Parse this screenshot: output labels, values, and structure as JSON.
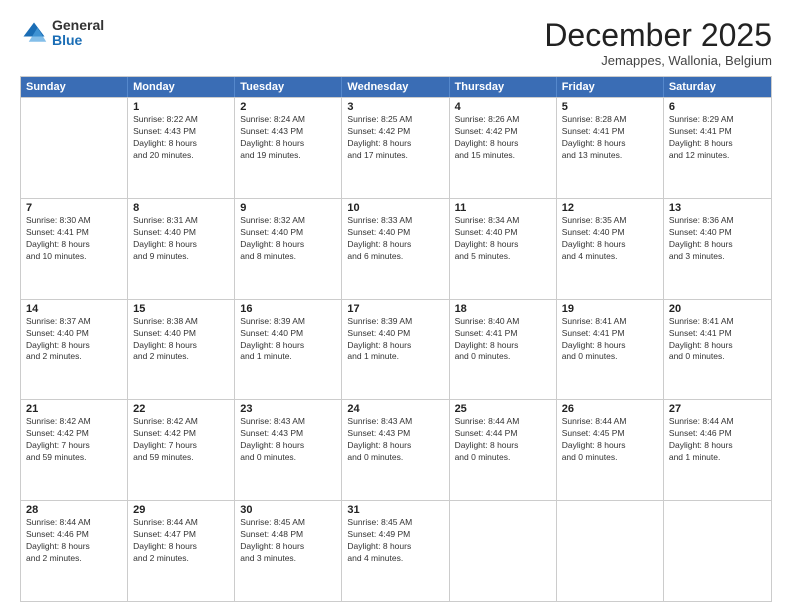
{
  "logo": {
    "general": "General",
    "blue": "Blue"
  },
  "title": "December 2025",
  "subtitle": "Jemappes, Wallonia, Belgium",
  "header_days": [
    "Sunday",
    "Monday",
    "Tuesday",
    "Wednesday",
    "Thursday",
    "Friday",
    "Saturday"
  ],
  "rows": [
    [
      {
        "day": "",
        "lines": []
      },
      {
        "day": "1",
        "lines": [
          "Sunrise: 8:22 AM",
          "Sunset: 4:43 PM",
          "Daylight: 8 hours",
          "and 20 minutes."
        ]
      },
      {
        "day": "2",
        "lines": [
          "Sunrise: 8:24 AM",
          "Sunset: 4:43 PM",
          "Daylight: 8 hours",
          "and 19 minutes."
        ]
      },
      {
        "day": "3",
        "lines": [
          "Sunrise: 8:25 AM",
          "Sunset: 4:42 PM",
          "Daylight: 8 hours",
          "and 17 minutes."
        ]
      },
      {
        "day": "4",
        "lines": [
          "Sunrise: 8:26 AM",
          "Sunset: 4:42 PM",
          "Daylight: 8 hours",
          "and 15 minutes."
        ]
      },
      {
        "day": "5",
        "lines": [
          "Sunrise: 8:28 AM",
          "Sunset: 4:41 PM",
          "Daylight: 8 hours",
          "and 13 minutes."
        ]
      },
      {
        "day": "6",
        "lines": [
          "Sunrise: 8:29 AM",
          "Sunset: 4:41 PM",
          "Daylight: 8 hours",
          "and 12 minutes."
        ]
      }
    ],
    [
      {
        "day": "7",
        "lines": [
          "Sunrise: 8:30 AM",
          "Sunset: 4:41 PM",
          "Daylight: 8 hours",
          "and 10 minutes."
        ]
      },
      {
        "day": "8",
        "lines": [
          "Sunrise: 8:31 AM",
          "Sunset: 4:40 PM",
          "Daylight: 8 hours",
          "and 9 minutes."
        ]
      },
      {
        "day": "9",
        "lines": [
          "Sunrise: 8:32 AM",
          "Sunset: 4:40 PM",
          "Daylight: 8 hours",
          "and 8 minutes."
        ]
      },
      {
        "day": "10",
        "lines": [
          "Sunrise: 8:33 AM",
          "Sunset: 4:40 PM",
          "Daylight: 8 hours",
          "and 6 minutes."
        ]
      },
      {
        "day": "11",
        "lines": [
          "Sunrise: 8:34 AM",
          "Sunset: 4:40 PM",
          "Daylight: 8 hours",
          "and 5 minutes."
        ]
      },
      {
        "day": "12",
        "lines": [
          "Sunrise: 8:35 AM",
          "Sunset: 4:40 PM",
          "Daylight: 8 hours",
          "and 4 minutes."
        ]
      },
      {
        "day": "13",
        "lines": [
          "Sunrise: 8:36 AM",
          "Sunset: 4:40 PM",
          "Daylight: 8 hours",
          "and 3 minutes."
        ]
      }
    ],
    [
      {
        "day": "14",
        "lines": [
          "Sunrise: 8:37 AM",
          "Sunset: 4:40 PM",
          "Daylight: 8 hours",
          "and 2 minutes."
        ]
      },
      {
        "day": "15",
        "lines": [
          "Sunrise: 8:38 AM",
          "Sunset: 4:40 PM",
          "Daylight: 8 hours",
          "and 2 minutes."
        ]
      },
      {
        "day": "16",
        "lines": [
          "Sunrise: 8:39 AM",
          "Sunset: 4:40 PM",
          "Daylight: 8 hours",
          "and 1 minute."
        ]
      },
      {
        "day": "17",
        "lines": [
          "Sunrise: 8:39 AM",
          "Sunset: 4:40 PM",
          "Daylight: 8 hours",
          "and 1 minute."
        ]
      },
      {
        "day": "18",
        "lines": [
          "Sunrise: 8:40 AM",
          "Sunset: 4:41 PM",
          "Daylight: 8 hours",
          "and 0 minutes."
        ]
      },
      {
        "day": "19",
        "lines": [
          "Sunrise: 8:41 AM",
          "Sunset: 4:41 PM",
          "Daylight: 8 hours",
          "and 0 minutes."
        ]
      },
      {
        "day": "20",
        "lines": [
          "Sunrise: 8:41 AM",
          "Sunset: 4:41 PM",
          "Daylight: 8 hours",
          "and 0 minutes."
        ]
      }
    ],
    [
      {
        "day": "21",
        "lines": [
          "Sunrise: 8:42 AM",
          "Sunset: 4:42 PM",
          "Daylight: 7 hours",
          "and 59 minutes."
        ]
      },
      {
        "day": "22",
        "lines": [
          "Sunrise: 8:42 AM",
          "Sunset: 4:42 PM",
          "Daylight: 7 hours",
          "and 59 minutes."
        ]
      },
      {
        "day": "23",
        "lines": [
          "Sunrise: 8:43 AM",
          "Sunset: 4:43 PM",
          "Daylight: 8 hours",
          "and 0 minutes."
        ]
      },
      {
        "day": "24",
        "lines": [
          "Sunrise: 8:43 AM",
          "Sunset: 4:43 PM",
          "Daylight: 8 hours",
          "and 0 minutes."
        ]
      },
      {
        "day": "25",
        "lines": [
          "Sunrise: 8:44 AM",
          "Sunset: 4:44 PM",
          "Daylight: 8 hours",
          "and 0 minutes."
        ]
      },
      {
        "day": "26",
        "lines": [
          "Sunrise: 8:44 AM",
          "Sunset: 4:45 PM",
          "Daylight: 8 hours",
          "and 0 minutes."
        ]
      },
      {
        "day": "27",
        "lines": [
          "Sunrise: 8:44 AM",
          "Sunset: 4:46 PM",
          "Daylight: 8 hours",
          "and 1 minute."
        ]
      }
    ],
    [
      {
        "day": "28",
        "lines": [
          "Sunrise: 8:44 AM",
          "Sunset: 4:46 PM",
          "Daylight: 8 hours",
          "and 2 minutes."
        ]
      },
      {
        "day": "29",
        "lines": [
          "Sunrise: 8:44 AM",
          "Sunset: 4:47 PM",
          "Daylight: 8 hours",
          "and 2 minutes."
        ]
      },
      {
        "day": "30",
        "lines": [
          "Sunrise: 8:45 AM",
          "Sunset: 4:48 PM",
          "Daylight: 8 hours",
          "and 3 minutes."
        ]
      },
      {
        "day": "31",
        "lines": [
          "Sunrise: 8:45 AM",
          "Sunset: 4:49 PM",
          "Daylight: 8 hours",
          "and 4 minutes."
        ]
      },
      {
        "day": "",
        "lines": []
      },
      {
        "day": "",
        "lines": []
      },
      {
        "day": "",
        "lines": []
      }
    ]
  ]
}
